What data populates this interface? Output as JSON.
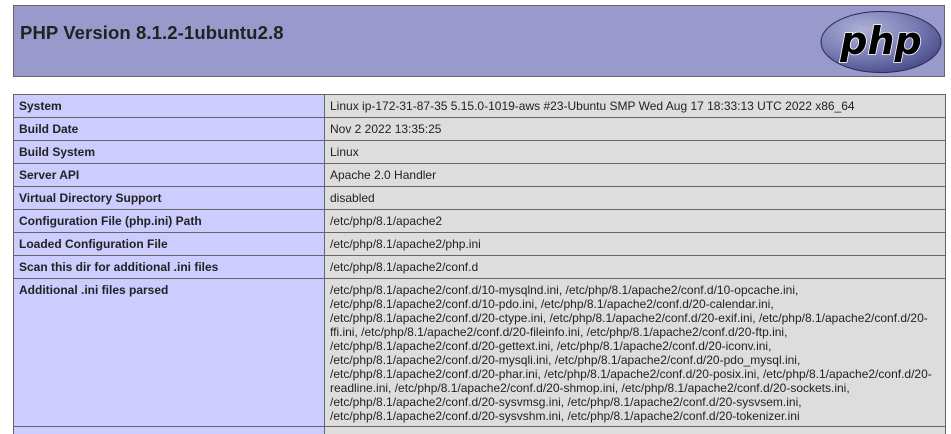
{
  "header": {
    "title": "PHP Version 8.1.2-1ubuntu2.8",
    "logo_text": "php",
    "background": "#9999cc"
  },
  "colors": {
    "label_background": "#ccccff",
    "value_background": "#dddddd",
    "border": "#666666",
    "logo_fill": "#777bb3"
  },
  "rows": [
    {
      "label": "System",
      "value": "Linux ip-172-31-87-35 5.15.0-1019-aws #23-Ubuntu SMP Wed Aug 17 18:33:13 UTC 2022 x86_64"
    },
    {
      "label": "Build Date",
      "value": "Nov 2 2022 13:35:25"
    },
    {
      "label": "Build System",
      "value": "Linux"
    },
    {
      "label": "Server API",
      "value": "Apache 2.0 Handler"
    },
    {
      "label": "Virtual Directory Support",
      "value": "disabled"
    },
    {
      "label": "Configuration File (php.ini) Path",
      "value": "/etc/php/8.1/apache2"
    },
    {
      "label": "Loaded Configuration File",
      "value": "/etc/php/8.1/apache2/php.ini"
    },
    {
      "label": "Scan this dir for additional .ini files",
      "value": "/etc/php/8.1/apache2/conf.d"
    },
    {
      "label": "Additional .ini files parsed",
      "value": "/etc/php/8.1/apache2/conf.d/10-mysqlnd.ini, /etc/php/8.1/apache2/conf.d/10-opcache.ini, /etc/php/8.1/apache2/conf.d/10-pdo.ini, /etc/php/8.1/apache2/conf.d/20-calendar.ini, /etc/php/8.1/apache2/conf.d/20-ctype.ini, /etc/php/8.1/apache2/conf.d/20-exif.ini, /etc/php/8.1/apache2/conf.d/20-ffi.ini, /etc/php/8.1/apache2/conf.d/20-fileinfo.ini, /etc/php/8.1/apache2/conf.d/20-ftp.ini, /etc/php/8.1/apache2/conf.d/20-gettext.ini, /etc/php/8.1/apache2/conf.d/20-iconv.ini, /etc/php/8.1/apache2/conf.d/20-mysqli.ini, /etc/php/8.1/apache2/conf.d/20-pdo_mysql.ini, /etc/php/8.1/apache2/conf.d/20-phar.ini, /etc/php/8.1/apache2/conf.d/20-posix.ini, /etc/php/8.1/apache2/conf.d/20-readline.ini, /etc/php/8.1/apache2/conf.d/20-shmop.ini, /etc/php/8.1/apache2/conf.d/20-sockets.ini, /etc/php/8.1/apache2/conf.d/20-sysvmsg.ini, /etc/php/8.1/apache2/conf.d/20-sysvsem.ini, /etc/php/8.1/apache2/conf.d/20-sysvshm.ini, /etc/php/8.1/apache2/conf.d/20-tokenizer.ini"
    },
    {
      "label": "",
      "value": ""
    }
  ]
}
